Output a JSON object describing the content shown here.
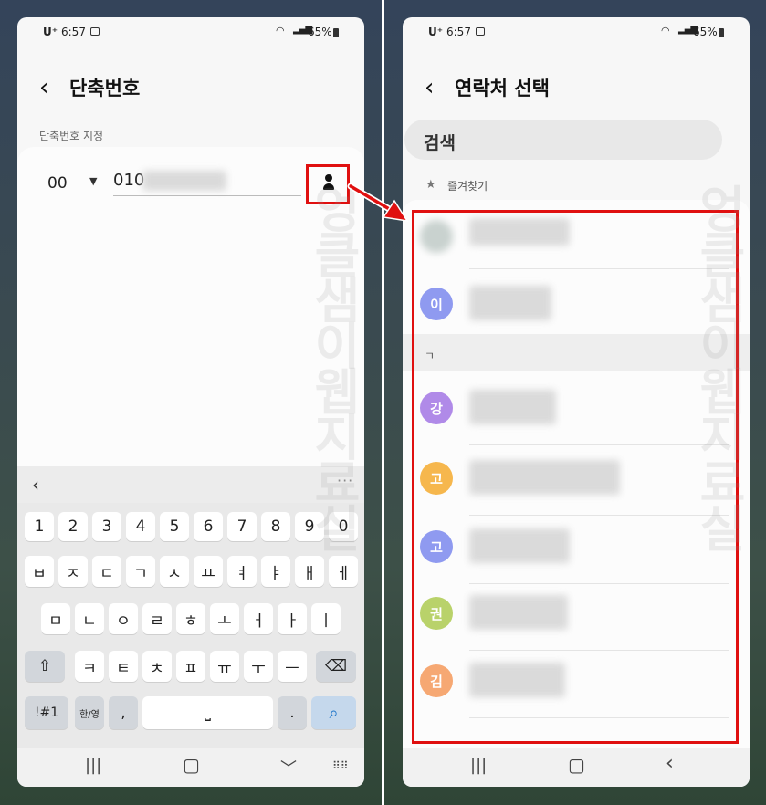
{
  "left": {
    "status": {
      "carrier": "U⁺",
      "time": "6:57",
      "battery": "65%"
    },
    "header": {
      "title": "단축번호"
    },
    "section_label": "단축번호 지정",
    "field": {
      "code": "00",
      "number": "010"
    },
    "keyboard": {
      "row_numbers": [
        "1",
        "2",
        "3",
        "4",
        "5",
        "6",
        "7",
        "8",
        "9",
        "0"
      ],
      "row1": [
        "ㅂ",
        "ㅈ",
        "ㄷ",
        "ㄱ",
        "ㅅ",
        "ㅛ",
        "ㅕ",
        "ㅑ",
        "ㅐ",
        "ㅔ"
      ],
      "row2": [
        "ㅁ",
        "ㄴ",
        "ㅇ",
        "ㄹ",
        "ㅎ",
        "ㅗ",
        "ㅓ",
        "ㅏ",
        "ㅣ"
      ],
      "row3": [
        "ㅋ",
        "ㅌ",
        "ㅊ",
        "ㅍ",
        "ㅠ",
        "ㅜ",
        "ㅡ"
      ],
      "symbols_key": "!#1",
      "lang_key": "한/영",
      "comma_key": ",",
      "period_key": "."
    }
  },
  "right": {
    "status": {
      "carrier": "U⁺",
      "time": "6:57",
      "battery": "65%"
    },
    "header": {
      "title": "연락처 선택"
    },
    "search": {
      "placeholder": "검색"
    },
    "favorites_label": "즐겨찾기",
    "group_label": "ㄱ",
    "contacts": [
      {
        "initial": "이",
        "color": "#8f9af0"
      },
      {
        "initial": "강",
        "color": "#b08ae8"
      },
      {
        "initial": "고",
        "color": "#f6b74d"
      },
      {
        "initial": "고",
        "color": "#8f9af0"
      },
      {
        "initial": "권",
        "color": "#b9d26a"
      },
      {
        "initial": "김",
        "color": "#f6a873"
      }
    ]
  },
  "watermark": "엉클샘이웹지료실"
}
